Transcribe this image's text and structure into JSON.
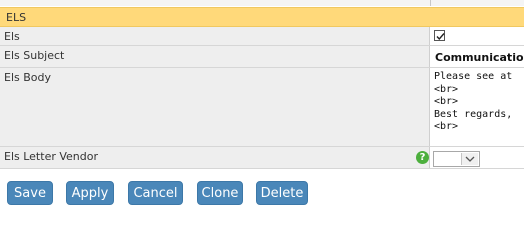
{
  "section": {
    "title": "ELS"
  },
  "fields": {
    "els": {
      "label": "Els",
      "checked": true
    },
    "subject": {
      "label": "Els Subject",
      "value": "Communication"
    },
    "body": {
      "label": "Els Body",
      "value": "Please see at\n<br>\n<br>\nBest regards,\n<br>"
    },
    "vendor": {
      "label": "Els Letter Vendor",
      "help_icon": "question-icon",
      "selected": ""
    }
  },
  "buttons": {
    "save": "Save",
    "apply": "Apply",
    "cancel": "Cancel",
    "clone": "Clone",
    "delete": "Delete"
  },
  "colors": {
    "header_bg": "#ffd97a",
    "button_bg": "#4a87b9",
    "help_icon": "#4caf3d"
  }
}
